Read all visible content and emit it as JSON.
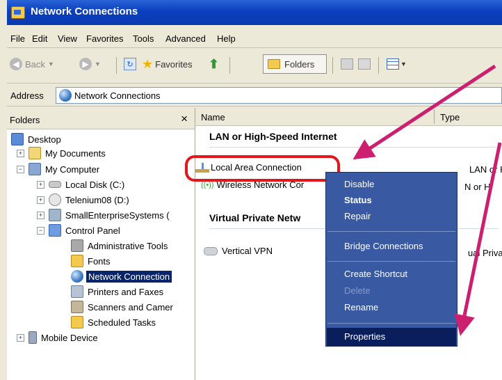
{
  "window": {
    "title": "Network Connections"
  },
  "menu": [
    "File",
    "Edit",
    "View",
    "Favorites",
    "Tools",
    "Advanced",
    "Help"
  ],
  "toolbar": {
    "back": "Back",
    "favorites": "Favorites",
    "folders": "Folders"
  },
  "address": {
    "label": "Address",
    "value": "Network Connections"
  },
  "folders_pane": {
    "title": "Folders",
    "close": "×",
    "items": [
      "Desktop",
      "My Documents",
      "My Computer",
      "Local Disk (C:)",
      "Telenium08 (D:)",
      "SmallEnterpriseSystems (",
      "Control Panel",
      "Administrative Tools",
      "Fonts",
      "Network Connection",
      "Printers and Faxes",
      "Scanners and Camer",
      "Scheduled Tasks",
      "Mobile Device"
    ]
  },
  "content": {
    "columns": [
      "Name",
      "Type"
    ],
    "group_lan": "LAN or High-Speed Internet",
    "lan_items": [
      {
        "name": "Local Area Connection",
        "type": "LAN or Hi"
      },
      {
        "name": "Wireless Network Cor",
        "type": "N or H"
      }
    ],
    "group_vpn": "Virtual Private Netw",
    "vpn_items": [
      {
        "name": "Vertical VPN",
        "type": "ual Priva"
      }
    ]
  },
  "context_menu": [
    "Disable",
    "Status",
    "Repair",
    "Bridge Connections",
    "Create Shortcut",
    "Delete",
    "Rename",
    "Properties"
  ],
  "colors": {
    "title_bar": "#0a3fbe",
    "context_menu_bg": "#395aa3",
    "highlight_box": "#e3161c",
    "arrow": "#cc1f6f"
  }
}
